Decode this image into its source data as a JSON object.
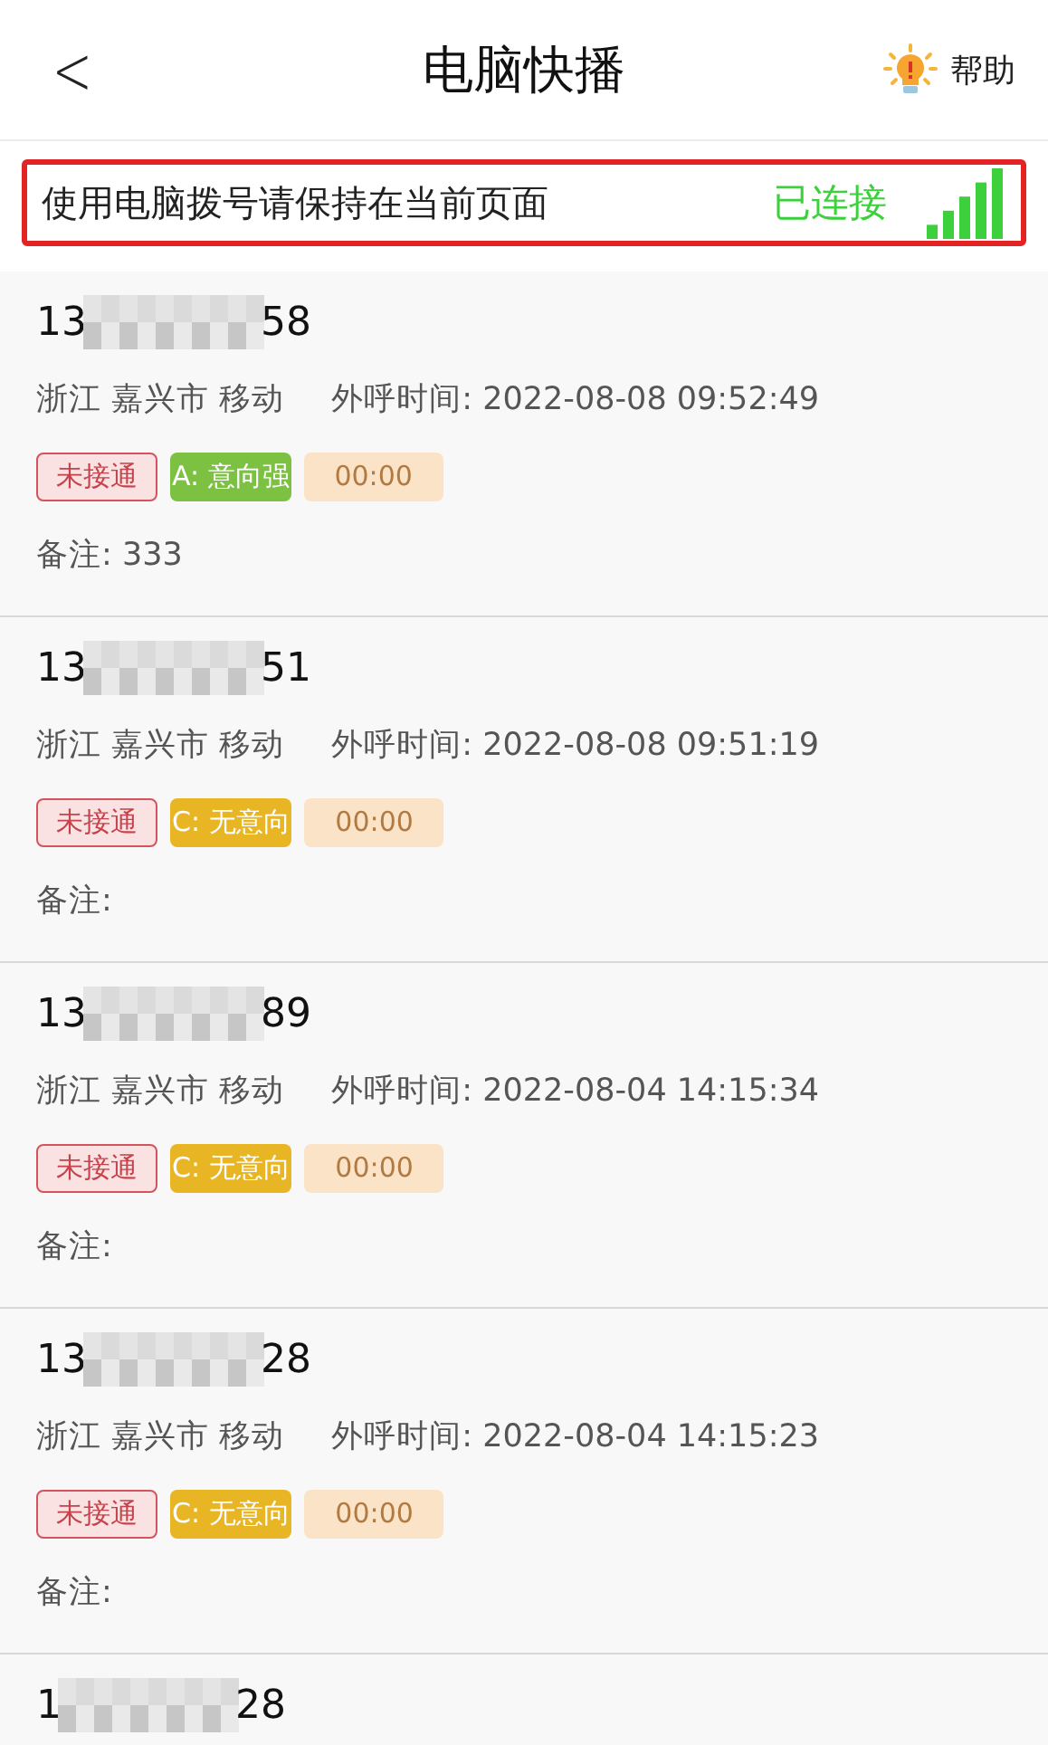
{
  "header": {
    "back": "<",
    "title": "电脑快播",
    "help": "帮助"
  },
  "banner": {
    "message": "使用电脑拨号请保持在当前页面",
    "status": "已连接",
    "connected": true
  },
  "records": [
    {
      "phone_start": "13",
      "phone_end": "58",
      "location": "浙江 嘉兴市 移动",
      "time_label": "外呼时间:",
      "time": "2022-08-08 09:52:49",
      "tags": [
        {
          "kind": "status",
          "text": "未接通"
        },
        {
          "kind": "intent",
          "text": "A: 意向强",
          "color": "#7cc142"
        },
        {
          "kind": "duration",
          "text": "00:00"
        }
      ],
      "remark_label": "备注:",
      "remark": "333"
    },
    {
      "phone_start": "13",
      "phone_end": "51",
      "location": "浙江 嘉兴市 移动",
      "time_label": "外呼时间:",
      "time": "2022-08-08 09:51:19",
      "tags": [
        {
          "kind": "status",
          "text": "未接通"
        },
        {
          "kind": "intent",
          "text": "C: 无意向",
          "color": "#e8b624"
        },
        {
          "kind": "duration",
          "text": "00:00"
        }
      ],
      "remark_label": "备注:"
    },
    {
      "phone_start": "13",
      "phone_end": "89",
      "location": "浙江 嘉兴市 移动",
      "time_label": "外呼时间:",
      "time": "2022-08-04 14:15:34",
      "tags": [
        {
          "kind": "status",
          "text": "未接通"
        },
        {
          "kind": "intent",
          "text": "C: 无意向",
          "color": "#e8b624"
        },
        {
          "kind": "duration",
          "text": "00:00"
        }
      ],
      "remark_label": "备注:"
    },
    {
      "phone_start": "13",
      "phone_end": "28",
      "location": "浙江 嘉兴市 移动",
      "time_label": "外呼时间:",
      "time": "2022-08-04 14:15:23",
      "tags": [
        {
          "kind": "status",
          "text": "未接通"
        },
        {
          "kind": "intent",
          "text": "C: 无意向",
          "color": "#e8b624"
        },
        {
          "kind": "duration",
          "text": "00:00"
        }
      ],
      "remark_label": "备注:"
    },
    {
      "phone_start": "1",
      "phone_end": "28"
    }
  ]
}
